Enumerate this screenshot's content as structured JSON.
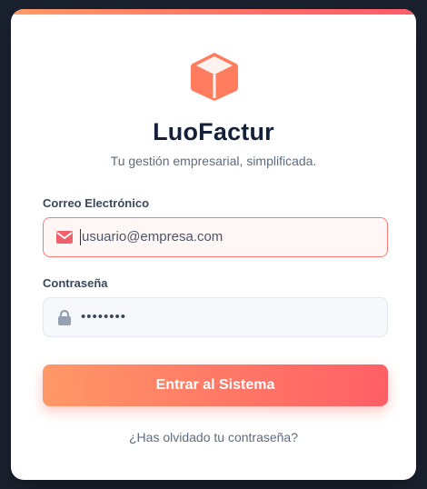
{
  "app": {
    "brand_name": "LuoFactur",
    "tagline": "Tu gestión empresarial, simplificada.",
    "logo_icon": "box-icon"
  },
  "form": {
    "email_label": "Correo Electrónico",
    "email_value": "usuario@empresa.com",
    "email_icon": "envelope-icon",
    "password_label": "Contraseña",
    "password_value": "••••••••",
    "password_icon": "lock-icon",
    "submit_label": "Entrar al Sistema",
    "forgot_link": "¿Has olvidado tu contraseña?"
  },
  "colors": {
    "accent_start": "#ff9a66",
    "accent_end": "#ff5a6a",
    "brand_text": "#15213a",
    "background": "#1b2230"
  }
}
